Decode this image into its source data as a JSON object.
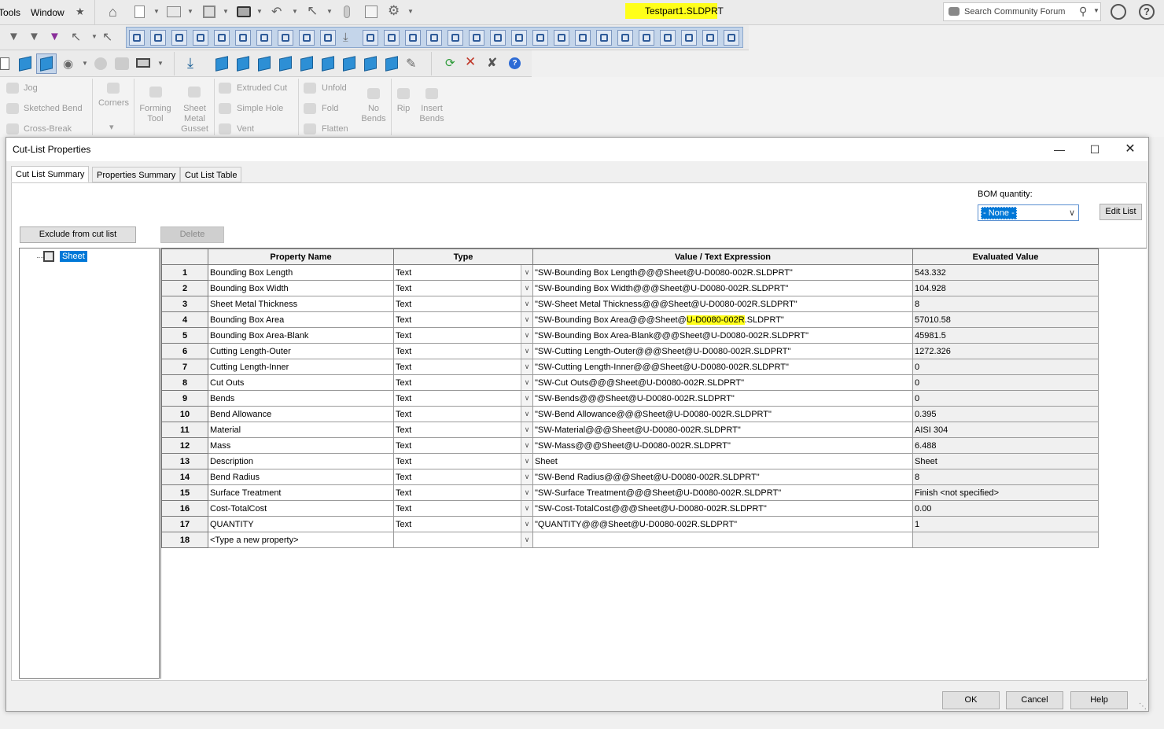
{
  "app": {
    "menu": [
      "Tools",
      "Window"
    ],
    "document_title": "Testpart1.SLDPRT",
    "search_placeholder": "Search Community Forum"
  },
  "ribbon": {
    "items": [
      {
        "label": "Jog"
      },
      {
        "label": "Sketched Bend"
      },
      {
        "label": "Cross-Break"
      },
      {
        "label": "Corners"
      },
      {
        "label": "Forming Tool"
      },
      {
        "label": "Sheet Metal Gusset"
      },
      {
        "label": "Extruded Cut"
      },
      {
        "label": "Simple Hole"
      },
      {
        "label": "Vent"
      },
      {
        "label": "Unfold"
      },
      {
        "label": "Fold"
      },
      {
        "label": "Flatten"
      },
      {
        "label": "No Bends"
      },
      {
        "label": "Rip"
      },
      {
        "label": "Insert Bends"
      }
    ]
  },
  "dialog": {
    "title": "Cut-List Properties",
    "tabs": [
      "Cut List Summary",
      "Properties Summary",
      "Cut List Table"
    ],
    "exclude_button": "Exclude from cut list",
    "delete_button": "Delete",
    "bom_label": "BOM quantity:",
    "bom_value": "- None -",
    "edit_list_button": "Edit List",
    "tree_root": "Sheet",
    "columns": [
      "Property Name",
      "Type",
      "Value / Text Expression",
      "Evaluated Value"
    ],
    "rows": [
      {
        "n": "1",
        "name": "Bounding Box Length",
        "type": "Text",
        "value": "\"SW-Bounding Box Length@@@Sheet@U-D0080-002R.SLDPRT\"",
        "evaluated": "543.332"
      },
      {
        "n": "2",
        "name": "Bounding Box Width",
        "type": "Text",
        "value": "\"SW-Bounding Box Width@@@Sheet@U-D0080-002R.SLDPRT\"",
        "evaluated": "104.928"
      },
      {
        "n": "3",
        "name": "Sheet Metal Thickness",
        "type": "Text",
        "value": "\"SW-Sheet Metal Thickness@@@Sheet@U-D0080-002R.SLDPRT\"",
        "evaluated": "8"
      },
      {
        "n": "4",
        "name": "Bounding Box Area",
        "type": "Text",
        "value_pre": "\"SW-Bounding Box Area@@@Sheet@",
        "value_hl": "U-D0080-002R",
        "value_post": ".SLDPRT\"",
        "evaluated": "57010.58"
      },
      {
        "n": "5",
        "name": "Bounding Box Area-Blank",
        "type": "Text",
        "value": "\"SW-Bounding Box Area-Blank@@@Sheet@U-D0080-002R.SLDPRT\"",
        "evaluated": "45981.5"
      },
      {
        "n": "6",
        "name": "Cutting Length-Outer",
        "type": "Text",
        "value": "\"SW-Cutting Length-Outer@@@Sheet@U-D0080-002R.SLDPRT\"",
        "evaluated": "1272.326"
      },
      {
        "n": "7",
        "name": "Cutting Length-Inner",
        "type": "Text",
        "value": "\"SW-Cutting Length-Inner@@@Sheet@U-D0080-002R.SLDPRT\"",
        "evaluated": "0"
      },
      {
        "n": "8",
        "name": "Cut Outs",
        "type": "Text",
        "value": "\"SW-Cut Outs@@@Sheet@U-D0080-002R.SLDPRT\"",
        "evaluated": "0"
      },
      {
        "n": "9",
        "name": "Bends",
        "type": "Text",
        "value": "\"SW-Bends@@@Sheet@U-D0080-002R.SLDPRT\"",
        "evaluated": "0"
      },
      {
        "n": "10",
        "name": "Bend Allowance",
        "type": "Text",
        "value": "\"SW-Bend Allowance@@@Sheet@U-D0080-002R.SLDPRT\"",
        "evaluated": "0.395"
      },
      {
        "n": "11",
        "name": "Material",
        "type": "Text",
        "value": "\"SW-Material@@@Sheet@U-D0080-002R.SLDPRT\"",
        "evaluated": "AISI 304"
      },
      {
        "n": "12",
        "name": "Mass",
        "type": "Text",
        "value": "\"SW-Mass@@@Sheet@U-D0080-002R.SLDPRT\"",
        "evaluated": "6.488"
      },
      {
        "n": "13",
        "name": "Description",
        "type": "Text",
        "value": "Sheet",
        "evaluated": "Sheet"
      },
      {
        "n": "14",
        "name": "Bend Radius",
        "type": "Text",
        "value": "\"SW-Bend Radius@@@Sheet@U-D0080-002R.SLDPRT\"",
        "evaluated": "8"
      },
      {
        "n": "15",
        "name": "Surface Treatment",
        "type": "Text",
        "value": "\"SW-Surface Treatment@@@Sheet@U-D0080-002R.SLDPRT\"",
        "evaluated": "Finish <not specified>"
      },
      {
        "n": "16",
        "name": "Cost-TotalCost",
        "type": "Text",
        "value": "\"SW-Cost-TotalCost@@@Sheet@U-D0080-002R.SLDPRT\"",
        "evaluated": "0.00"
      },
      {
        "n": "17",
        "name": "QUANTITY",
        "type": "Text",
        "value": "\"QUANTITY@@@Sheet@U-D0080-002R.SLDPRT\"",
        "evaluated": "1"
      },
      {
        "n": "18",
        "name": "<Type a new property>",
        "type": "",
        "value": "",
        "evaluated": ""
      }
    ],
    "ok_button": "OK",
    "cancel_button": "Cancel",
    "help_button": "Help"
  },
  "colors": {
    "highlight": "#ffff1a",
    "selection": "#0078d7",
    "toolbar_active": "#c4d5ea"
  }
}
